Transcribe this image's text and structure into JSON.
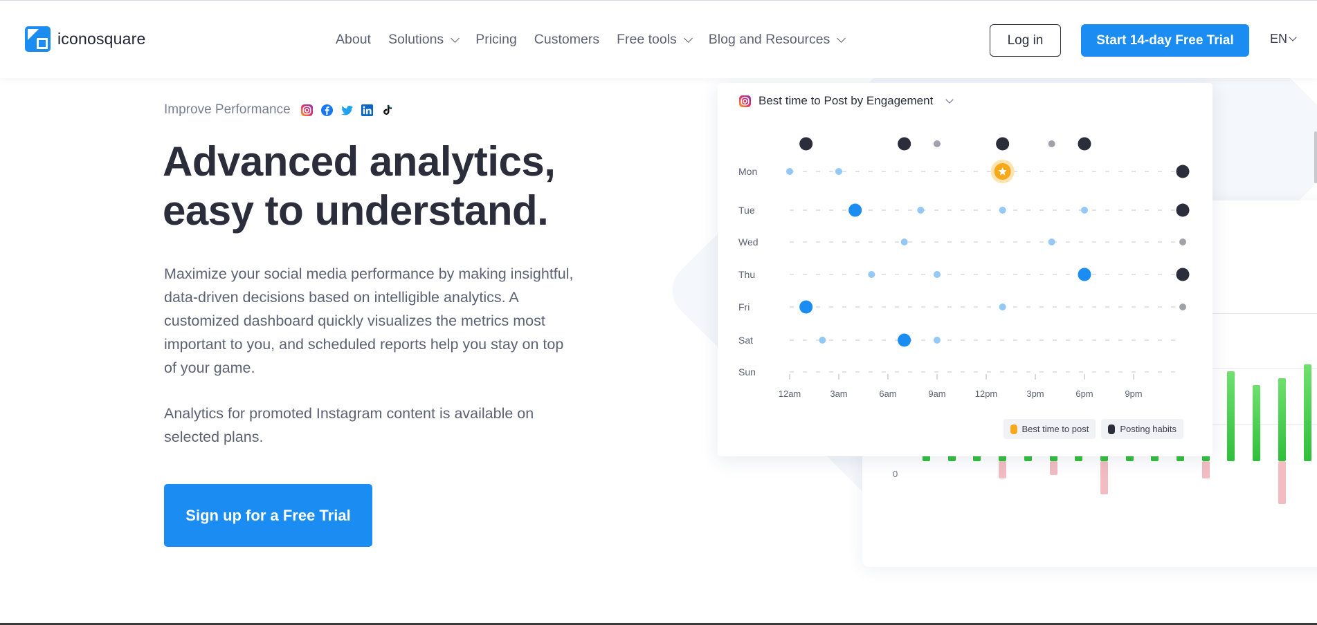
{
  "brand": {
    "name": "iconosquare",
    "logo_icon": "iconosquare-logo-icon",
    "accent": "#1a8cf2"
  },
  "nav": {
    "items": [
      {
        "label": "About",
        "dropdown": false
      },
      {
        "label": "Solutions",
        "dropdown": true
      },
      {
        "label": "Pricing",
        "dropdown": false
      },
      {
        "label": "Customers",
        "dropdown": false
      },
      {
        "label": "Free tools",
        "dropdown": true
      },
      {
        "label": "Blog and Resources",
        "dropdown": true
      }
    ],
    "login_label": "Log in",
    "trial_label": "Start 14-day Free Trial",
    "language": "EN"
  },
  "hero": {
    "eyebrow": "Improve Performance",
    "social_icons": [
      "instagram-icon",
      "facebook-icon",
      "twitter-icon",
      "linkedin-icon",
      "tiktok-icon"
    ],
    "headline_line1": "Advanced analytics,",
    "headline_line2": "easy to understand.",
    "paragraph1": "Maximize your social media performance by making insightful, data-driven decisions based on intelligible analytics. A customized dashboard quickly visualizes the metrics most important to you, and scheduled reports help you stay on top of your game.",
    "paragraph2": "Analytics for promoted Instagram content is available on selected plans.",
    "cta_label": "Sign up for a Free Trial"
  },
  "chart_data": [
    {
      "type": "scatter",
      "title": "Best time to Post by Engagement",
      "days": [
        "Mon",
        "Tue",
        "Wed",
        "Thu",
        "Fri",
        "Sat",
        "Sun"
      ],
      "x_tick_labels": [
        "12am",
        "3am",
        "6am",
        "9am",
        "12pm",
        "3pm",
        "6pm",
        "9pm"
      ],
      "x_range_hours": [
        0,
        24
      ],
      "habit_top_row_hours": [
        1,
        7,
        13,
        18
      ],
      "habit_top_row_small_hours": [
        9,
        16
      ],
      "points": [
        {
          "day": "Mon",
          "hour": 0,
          "size": "small"
        },
        {
          "day": "Mon",
          "hour": 3,
          "size": "small"
        },
        {
          "day": "Mon",
          "hour": 13,
          "size": "best"
        },
        {
          "day": "Tue",
          "hour": 4,
          "size": "large"
        },
        {
          "day": "Tue",
          "hour": 8,
          "size": "small"
        },
        {
          "day": "Tue",
          "hour": 13,
          "size": "small"
        },
        {
          "day": "Tue",
          "hour": 18,
          "size": "small"
        },
        {
          "day": "Wed",
          "hour": 7,
          "size": "small"
        },
        {
          "day": "Wed",
          "hour": 16,
          "size": "small"
        },
        {
          "day": "Thu",
          "hour": 5,
          "size": "small"
        },
        {
          "day": "Thu",
          "hour": 9,
          "size": "small"
        },
        {
          "day": "Thu",
          "hour": 18,
          "size": "large"
        },
        {
          "day": "Fri",
          "hour": 1,
          "size": "large"
        },
        {
          "day": "Fri",
          "hour": 13,
          "size": "small"
        },
        {
          "day": "Sat",
          "hour": 2,
          "size": "small"
        },
        {
          "day": "Sat",
          "hour": 7,
          "size": "large"
        },
        {
          "day": "Sat",
          "hour": 9,
          "size": "small"
        }
      ],
      "habit_right_column": [
        {
          "day": "Mon",
          "size": "large"
        },
        {
          "day": "Tue",
          "size": "large"
        },
        {
          "day": "Wed",
          "size": "small"
        },
        {
          "day": "Thu",
          "size": "large"
        },
        {
          "day": "Fri",
          "size": "small"
        }
      ],
      "legend": [
        {
          "label": "Best time to post",
          "color": "#f7a81b"
        },
        {
          "label": "Posting habits",
          "color": "#2b2d3b"
        }
      ],
      "colors": {
        "engagement": "#1a8cf2",
        "engagement_light": "#93c8f7",
        "habit": "#2b2d3b",
        "habit_light": "#9fa2ab",
        "best": "#f7a81b"
      }
    },
    {
      "type": "bar",
      "zero_label": "0",
      "positive_values": [
        60,
        60,
        60,
        60,
        60,
        60,
        60,
        60,
        60,
        60,
        60,
        60,
        130,
        110,
        120,
        140
      ],
      "negative_values": [
        0,
        0,
        0,
        25,
        0,
        20,
        0,
        48,
        0,
        0,
        0,
        25,
        0,
        0,
        62,
        0
      ],
      "colors": {
        "positive": "#39c945",
        "negative": "#f2bcc2"
      }
    }
  ]
}
